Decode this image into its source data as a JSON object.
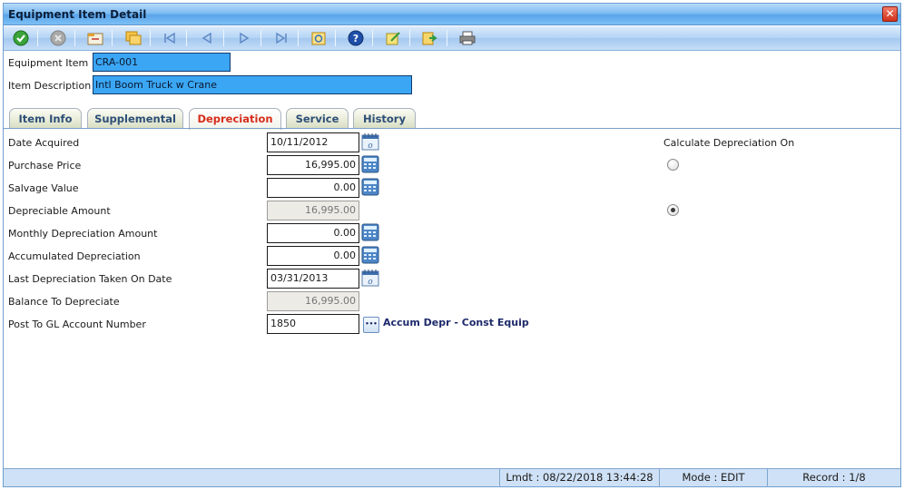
{
  "window": {
    "title": "Equipment Item Detail",
    "close_glyph": "✕"
  },
  "toolbar": {
    "buttons": [
      {
        "name": "save-check-icon"
      },
      {
        "name": "cancel-icon"
      },
      {
        "name": "open-folder-icon"
      },
      {
        "name": "copy-folders-icon"
      },
      {
        "name": "first-record-icon"
      },
      {
        "name": "previous-record-icon"
      },
      {
        "name": "next-record-icon"
      },
      {
        "name": "last-record-icon"
      },
      {
        "name": "refresh-icon"
      },
      {
        "name": "help-icon"
      },
      {
        "name": "notes-icon"
      },
      {
        "name": "export-icon"
      },
      {
        "name": "print-icon"
      }
    ]
  },
  "header": {
    "equipment_item_label": "Equipment Item",
    "equipment_item_value": "CRA-001",
    "item_description_label": "Item Description",
    "item_description_value": "Intl Boom Truck w Crane"
  },
  "tabs": [
    {
      "label": "Item Info"
    },
    {
      "label": "Supplemental"
    },
    {
      "label": "Depreciation",
      "active": true
    },
    {
      "label": "Service"
    },
    {
      "label": "History"
    }
  ],
  "form": {
    "date_acquired": {
      "label": "Date Acquired",
      "value": "10/11/2012"
    },
    "purchase_price": {
      "label": "Purchase Price",
      "value": "16,995.00"
    },
    "salvage_value": {
      "label": "Salvage Value",
      "value": "0.00"
    },
    "depreciable_amount": {
      "label": "Depreciable Amount",
      "value": "16,995.00"
    },
    "monthly_depreciation": {
      "label": "Monthly Depreciation Amount",
      "value": "0.00"
    },
    "accumulated_depreciation": {
      "label": "Accumulated Depreciation",
      "value": "0.00"
    },
    "last_depreciation_date": {
      "label": "Last Depreciation Taken On Date",
      "value": "03/31/2013"
    },
    "balance_to_depreciate": {
      "label": "Balance To Depreciate",
      "value": "16,995.00"
    },
    "gl_account": {
      "label": "Post To GL Account Number",
      "value": "1850",
      "lookup_glyph": "•••",
      "description": "Accum Depr - Const Equip"
    }
  },
  "calculate_on": {
    "label": "Calculate Depreciation On",
    "options": [
      {
        "checked": false
      },
      {
        "checked": true
      }
    ]
  },
  "status": {
    "lmdt": "Lmdt : 08/22/2018 13:44:28",
    "mode": "Mode : EDIT",
    "record": "Record : 1/8"
  },
  "colors": {
    "accent": "#3ba6f4",
    "active_tab": "#d62c1a",
    "link_text": "#1d2a6b"
  }
}
